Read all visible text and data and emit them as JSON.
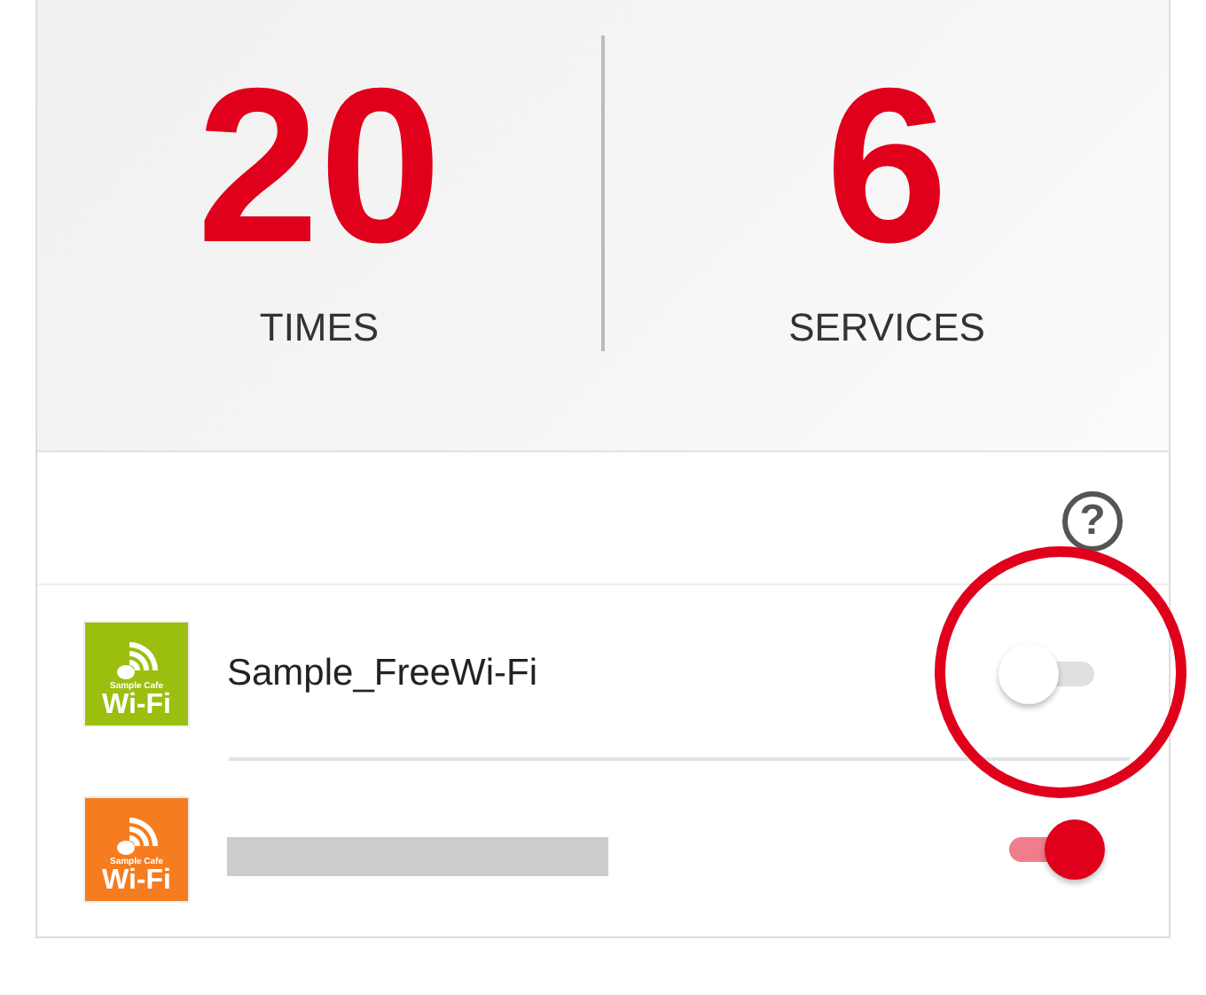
{
  "stats": [
    {
      "value": "20",
      "label": "TIMES"
    },
    {
      "value": "6",
      "label": "SERVICES"
    }
  ],
  "help": {
    "symbol": "?"
  },
  "networks": [
    {
      "logo_top": "Sample Cafe",
      "logo_bottom": "Wi-Fi",
      "color": "#9bbf0e",
      "name": "Sample_FreeWi-Fi",
      "on": false,
      "highlighted": true
    },
    {
      "logo_top": "Sample Cafe",
      "logo_bottom": "Wi-Fi",
      "color": "#f57c1f",
      "kind": "redacted",
      "on": true,
      "highlighted": false
    }
  ]
}
